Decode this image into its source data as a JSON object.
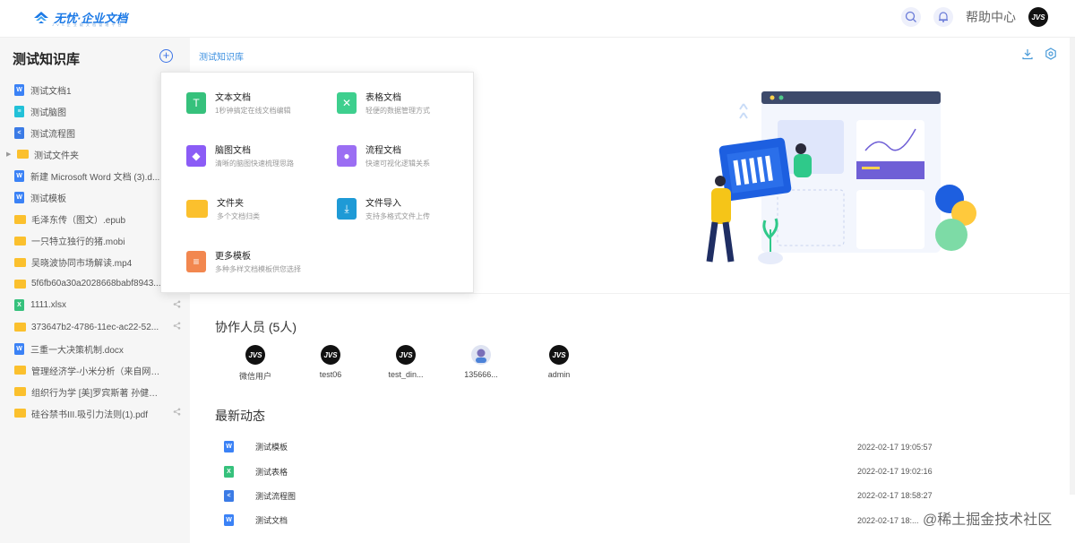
{
  "header": {
    "logo_text": "无忧·企业文档",
    "logo_sub": "J V S 企 业 级 文 档 管 理 平 台",
    "help_label": "帮助中心",
    "avatar_text": "JVS",
    "icons": [
      "search-icon",
      "bell-icon"
    ]
  },
  "sidebar": {
    "title": "测试知识库",
    "add_label": "+",
    "items": [
      {
        "label": "测试文档1",
        "type": "word"
      },
      {
        "label": "测试脑图",
        "type": "mind"
      },
      {
        "label": "测试流程图",
        "type": "flow"
      },
      {
        "label": "测试文件夹",
        "type": "folder",
        "caret": "▶"
      },
      {
        "label": "新建 Microsoft Word 文档 (3).d...",
        "type": "word"
      },
      {
        "label": "测试模板",
        "type": "word"
      },
      {
        "label": "毛泽东传（图文）.epub",
        "type": "folder"
      },
      {
        "label": "一只特立独行的猪.mobi",
        "type": "folder"
      },
      {
        "label": "吴晓波协同市场解读.mp4",
        "type": "folder"
      },
      {
        "label": "5f6fb60a30a2028668babf8943...",
        "type": "folder"
      },
      {
        "label": "1111.xlsx",
        "type": "excel",
        "share": true
      },
      {
        "label": "373647b2-4786-11ec-ac22-52...",
        "type": "folder",
        "share": true
      },
      {
        "label": "三重一大决策机制.docx",
        "type": "word"
      },
      {
        "label": "管理经济学-小米分析（来自网络...",
        "type": "folder"
      },
      {
        "label": "组织行为学 [美]罗宾斯著 孙健敏 ...",
        "type": "folder"
      },
      {
        "label": "硅谷禁书III.吸引力法则(1).pdf",
        "type": "folder",
        "share": true
      }
    ]
  },
  "main": {
    "breadcrumb": "测试知识库",
    "popup": {
      "items": [
        {
          "title": "文本文档",
          "desc": "1秒钟搞定在线文档编辑",
          "color": "#36c17c",
          "glyph": "T"
        },
        {
          "title": "表格文档",
          "desc": "轻便的数据管理方式",
          "color": "#3ecf8e",
          "glyph": "✕"
        },
        {
          "title": "脑图文档",
          "desc": "清晰的脑图快速梳理思路",
          "color": "#8b5cf6",
          "glyph": "◆"
        },
        {
          "title": "流程文档",
          "desc": "快速可视化逻辑关系",
          "color": "#9b6ef3",
          "glyph": "●"
        },
        {
          "title": "文件夹",
          "desc": "多个文档归类",
          "color": "#fbc02d",
          "glyph": ""
        },
        {
          "title": "文件导入",
          "desc": "支持多格式文件上传",
          "color": "#1e9ad6",
          "glyph": "⤓"
        },
        {
          "title": "更多模板",
          "desc": "多种多样文档模板供您选择",
          "color": "#f2874f",
          "glyph": "≡"
        }
      ]
    },
    "collaborators": {
      "title": "协作人员 (5人)",
      "members": [
        {
          "name": "微信用户",
          "avatar": "JVS"
        },
        {
          "name": "test06",
          "avatar": "JVS"
        },
        {
          "name": "test_din...",
          "avatar": "JVS"
        },
        {
          "name": "135666...",
          "avatar": "photo"
        },
        {
          "name": "admin",
          "avatar": "JVS"
        }
      ]
    },
    "news": {
      "title": "最新动态",
      "rows": [
        {
          "name": "测试模板",
          "type": "word",
          "time": "2022-02-17 19:05:57"
        },
        {
          "name": "测试表格",
          "type": "excel",
          "time": "2022-02-17 19:02:16"
        },
        {
          "name": "测试流程图",
          "type": "flow",
          "time": "2022-02-17 18:58:27"
        },
        {
          "name": "测试文档",
          "type": "word",
          "time": "2022-02-17 18:..."
        }
      ]
    }
  },
  "watermark": "@稀土掘金技术社区",
  "colors": {
    "accent": "#3b73e6",
    "word": "#3b82f6",
    "excel": "#36c17c",
    "folder": "#fbc02d",
    "mind": "#22c1d8",
    "flow": "#3b7be6"
  }
}
